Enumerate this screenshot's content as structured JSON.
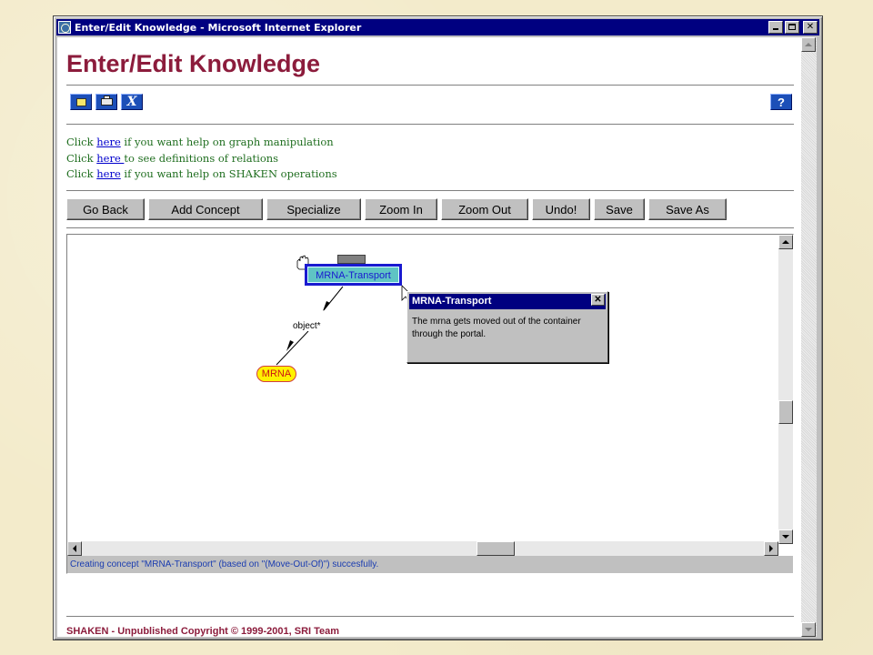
{
  "window": {
    "title": "Enter/Edit Knowledge - Microsoft Internet Explorer",
    "minimize": "_",
    "maximize": "□",
    "close": "✕"
  },
  "page": {
    "heading": "Enter/Edit Knowledge",
    "toolbar_icons": [
      "new-icon",
      "print-icon",
      "cut-icon",
      "help-icon"
    ],
    "help_label": "?",
    "help_lines": [
      {
        "prefix": "Click ",
        "link": "here",
        "suffix": " if you want help on graph manipulation"
      },
      {
        "prefix": "Click ",
        "link": "here ",
        "suffix": "to see definitions of relations"
      },
      {
        "prefix": "Click ",
        "link": "here",
        "suffix": " if you want help on SHAKEN operations"
      }
    ],
    "buttons": {
      "go_back": "Go Back",
      "add_concept": "Add Concept",
      "specialize": "Specialize",
      "zoom_in": "Zoom In",
      "zoom_out": "Zoom Out",
      "undo": "Undo!",
      "save": "Save",
      "save_as": "Save As"
    }
  },
  "graph": {
    "root_concept": "MRNA-Transport",
    "child_concept": "MRNA",
    "edge_label": "object*",
    "popup": {
      "title": "MRNA-Transport",
      "close": "✕",
      "body": "The mrna gets moved out of the container through the portal."
    },
    "status": "Creating concept \"MRNA-Transport\" (based on \"(Move-Out-Of)\") succesfully."
  },
  "footer": {
    "text": "SHAKEN - Unpublished Copyright © 1999-2001, SRI Team"
  },
  "colors": {
    "title_bar": "#000080",
    "heading": "#8c1c3c",
    "help_text": "#1f6e1f",
    "link": "#0000cc",
    "concept_fill": "#5fc4c4",
    "concept_border": "#1a1ad0",
    "mrna_fill": "#fff200",
    "status_text": "#1a3cb0"
  }
}
